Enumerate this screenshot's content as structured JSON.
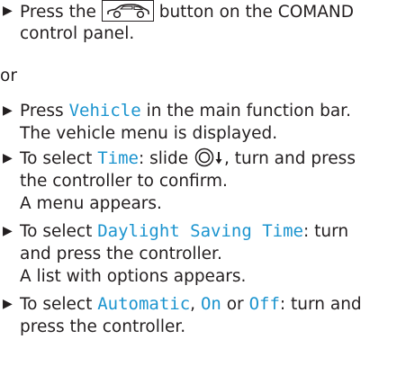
{
  "bullet": "▶",
  "colors": {
    "text": "#231f20",
    "highlight": "#1b94cf"
  },
  "icons": {
    "vehicle_button": "car-button-icon",
    "controller": "controller-slide-down-icon"
  },
  "step1": {
    "pre": "Press the",
    "post": "button on the COMAND",
    "line2": "control panel."
  },
  "or": "or",
  "step2": {
    "pre": "Press",
    "highlight": "Vehicle",
    "post": "in the main function bar.",
    "line2": "The vehicle menu is displayed."
  },
  "step3": {
    "pre": "To select",
    "highlight": "Time",
    "mid": ": slide",
    "post": ", turn and press",
    "line2": "the controller to confirm.",
    "line3": "A menu appears."
  },
  "step4": {
    "pre": "To select",
    "highlight": "Daylight Saving Time",
    "post": ": turn",
    "line2": "and press the controller.",
    "line3": "A list with options appears."
  },
  "step5": {
    "pre": "To select",
    "opt1": "Automatic",
    "sep1": ",",
    "opt2": "On",
    "sep2": "or",
    "opt3": "Off",
    "post": ": turn and",
    "line2": "press the controller."
  }
}
